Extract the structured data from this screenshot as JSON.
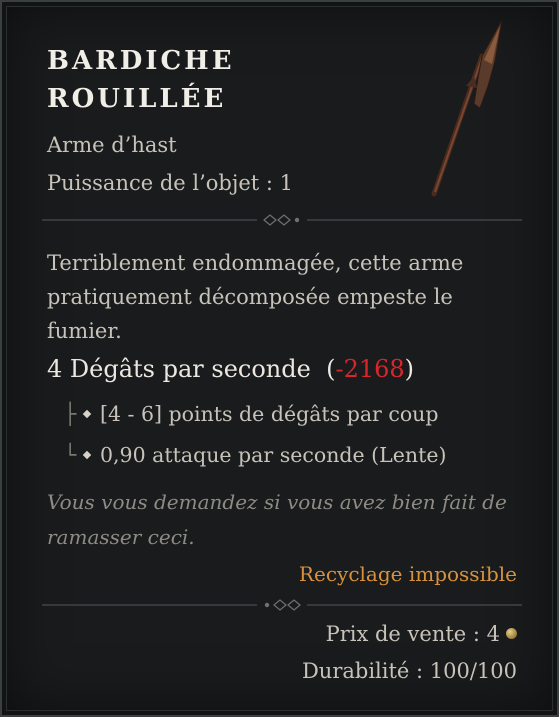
{
  "item": {
    "name": "BARDICHE\nROUILLÉE",
    "type": "Arme d’hast",
    "power": "Puissance de l’objet : 1",
    "description": "Terriblement endommagée, cette arme pratiquement décomposée empeste le fumier.",
    "dps_value": "4 Dégâts par seconde",
    "dps_compare_open": "(",
    "dps_compare_value": "-2168",
    "dps_compare_close": ")",
    "stat_damage": "[4 - 6] points de dégâts par coup",
    "stat_speed": "0,90 attaque par seconde (Lente)",
    "flavor": "Vous vous demandez si vous avez bien fait de ramasser ceci.",
    "recycle": "Recyclage impossible",
    "sell_price": "Prix de vente : 4",
    "durability": "Durabilité : 100/100"
  },
  "icons": {
    "weapon": "polearm-bardiche-icon",
    "coin": "gold-coin-icon"
  },
  "colors": {
    "title": "#f1eee8",
    "negative": "#d8262a",
    "recycle": "#d8923e",
    "flavor": "#8e8a84"
  }
}
